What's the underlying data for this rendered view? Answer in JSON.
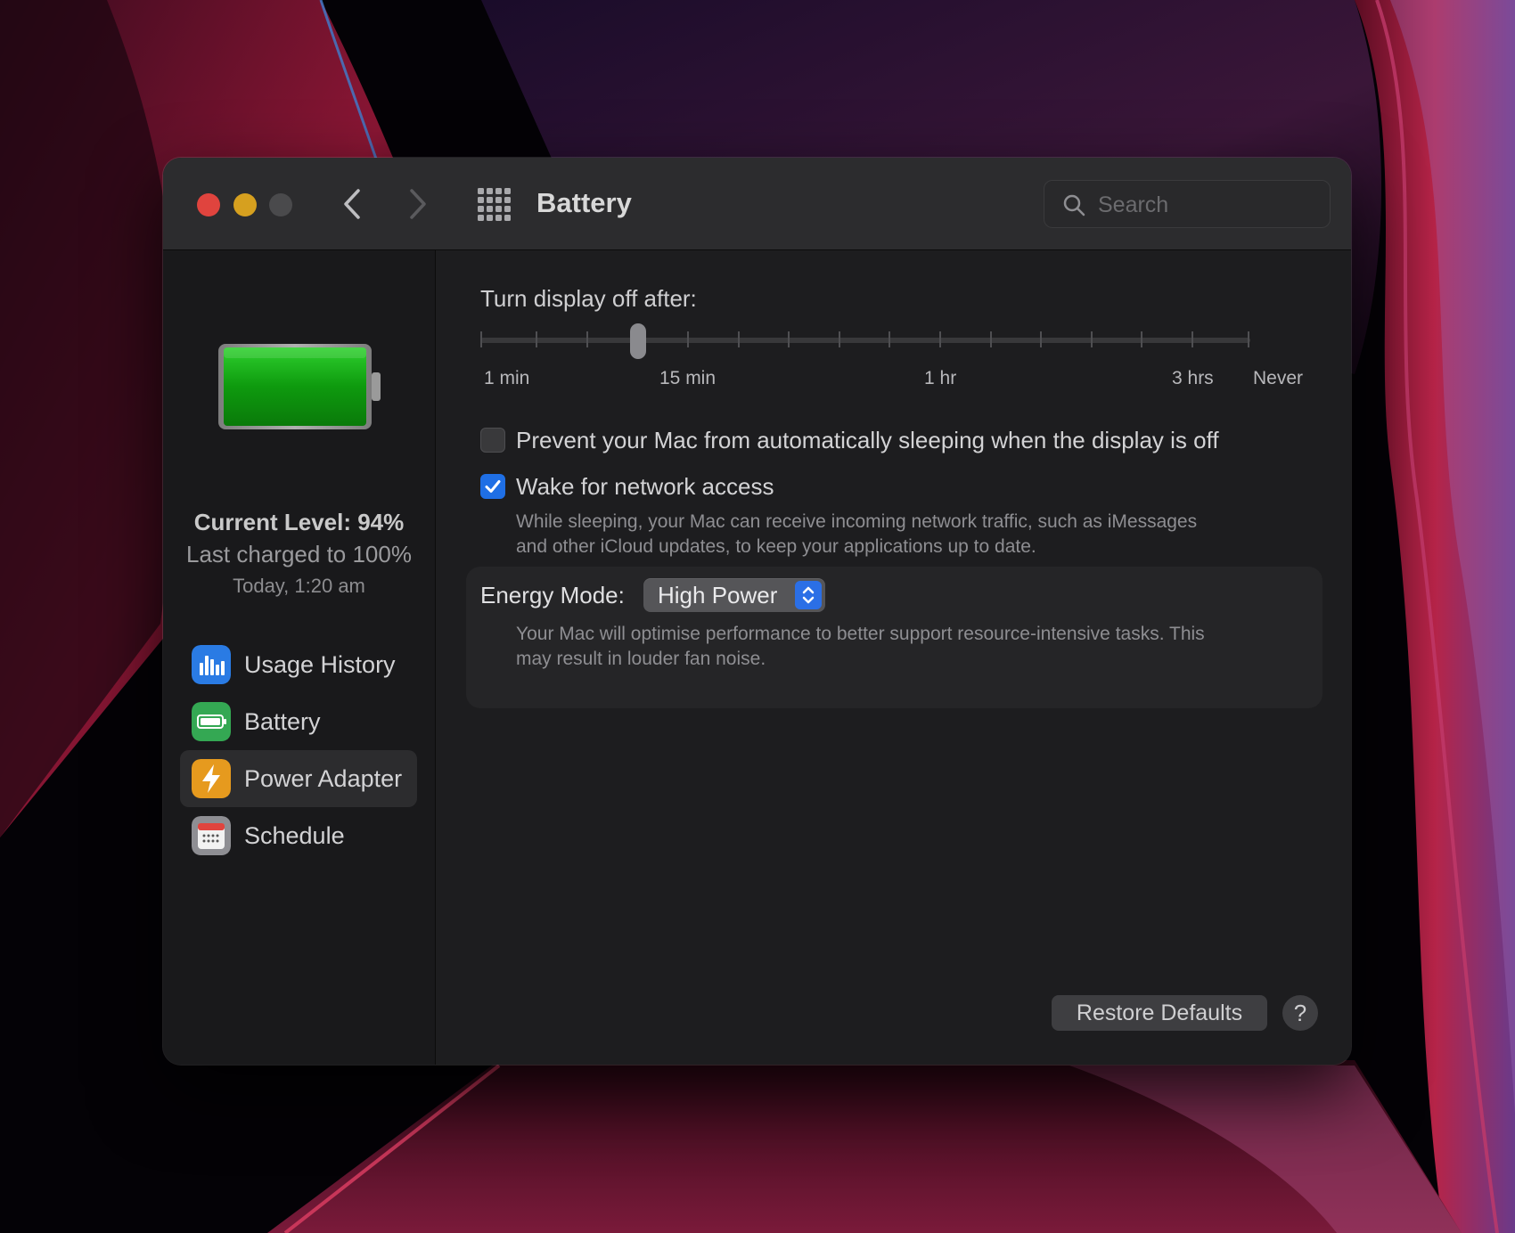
{
  "window": {
    "title": "Battery",
    "search_placeholder": "Search"
  },
  "icons": {
    "close": "traffic-light-close",
    "minimize": "traffic-light-minimize",
    "zoom": "traffic-light-zoom",
    "back": "chevron-left-icon",
    "forward": "chevron-right-icon",
    "all_prefs": "grid-icon",
    "search": "magnifier-icon"
  },
  "sidebar": {
    "battery_level_percent": 94,
    "current_level": "Current Level: 94%",
    "last_charged": "Last charged to 100%",
    "charged_time": "Today, 1:20 am",
    "items": [
      {
        "label": "Usage History",
        "icon": "bar-chart-icon",
        "color": "#2a7be4",
        "selected": false
      },
      {
        "label": "Battery",
        "icon": "battery-icon",
        "color": "#34a853",
        "selected": false
      },
      {
        "label": "Power Adapter",
        "icon": "lightning-icon",
        "color": "#e69a1e",
        "selected": true
      },
      {
        "label": "Schedule",
        "icon": "calendar-icon",
        "color": "#8e8e93",
        "selected": false
      }
    ]
  },
  "display_slider": {
    "title": "Turn display off after:",
    "labels": [
      "1 min",
      "15 min",
      "1 hr",
      "3 hrs",
      "Never"
    ],
    "value": "10 min"
  },
  "options": {
    "prevent_sleep": {
      "label": "Prevent your Mac from automatically sleeping when the display is off",
      "checked": false
    },
    "wake_network": {
      "label": "Wake for network access",
      "checked": true,
      "description_line1": "While sleeping, your Mac can receive incoming network traffic, such as iMessages",
      "description_line2": "and other iCloud updates, to keep your applications up to date."
    }
  },
  "energy_mode": {
    "label": "Energy Mode:",
    "value": "High Power",
    "description_line1": "Your Mac will optimise performance to better support resource-intensive tasks. This",
    "description_line2": "may result in louder fan noise."
  },
  "footer": {
    "restore_label": "Restore Defaults",
    "help_label": "?"
  },
  "colors": {
    "accent": "#1f6fe5",
    "window_bg": "#1d1d1f",
    "battery_fill": "#1aa51a"
  }
}
